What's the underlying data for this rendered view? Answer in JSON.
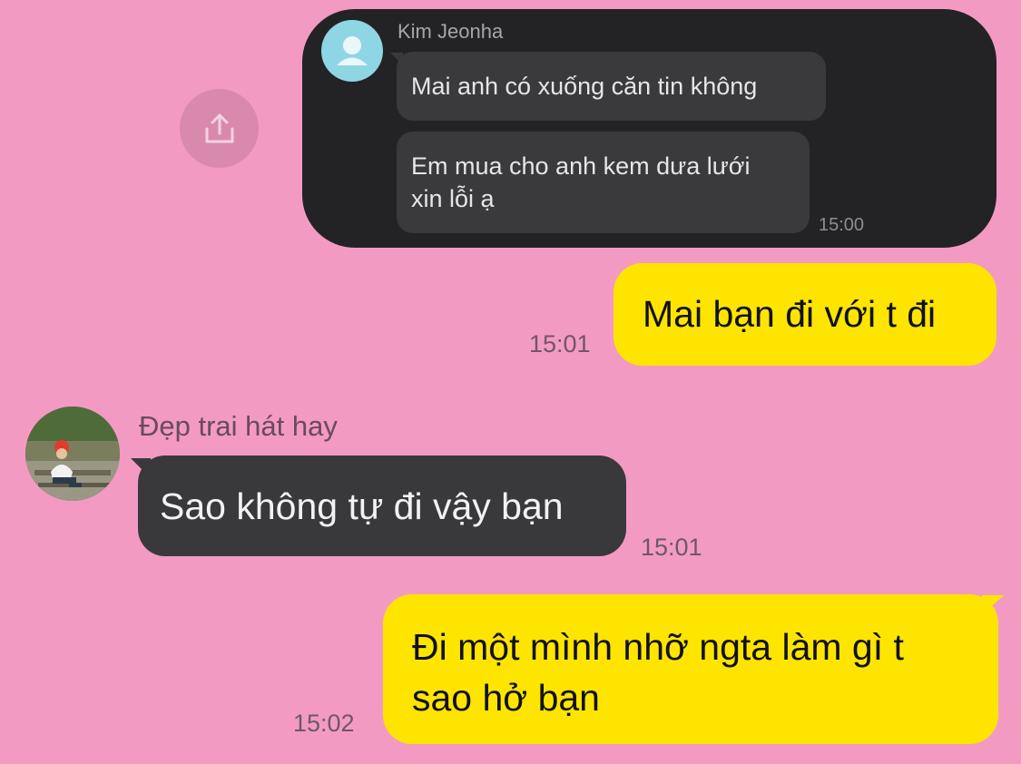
{
  "forwarded": {
    "share_icon": "share-upload-icon",
    "avatar_icon": "default-person-icon",
    "sender_name": "Kim Jeonha",
    "messages": [
      "Mai anh có xuống căn tin không",
      "Em mua cho anh kem dưa lưới\nxin lỗi ạ"
    ],
    "time": "15:00"
  },
  "chat": [
    {
      "side": "out",
      "text": "Mai bạn đi với t đi",
      "time": "15:01"
    },
    {
      "side": "in",
      "sender": "Đẹp trai hát hay",
      "text": "Sao không tự đi vậy bạn",
      "time": "15:01"
    },
    {
      "side": "out",
      "text": "Đi một mình nhỡ ngta làm gì t\nsao hở bạn",
      "time": "15:02"
    }
  ],
  "colors": {
    "background": "#f39ac3",
    "outgoing_bubble": "#fee500",
    "incoming_bubble": "#39393b",
    "forward_card": "#232325"
  }
}
